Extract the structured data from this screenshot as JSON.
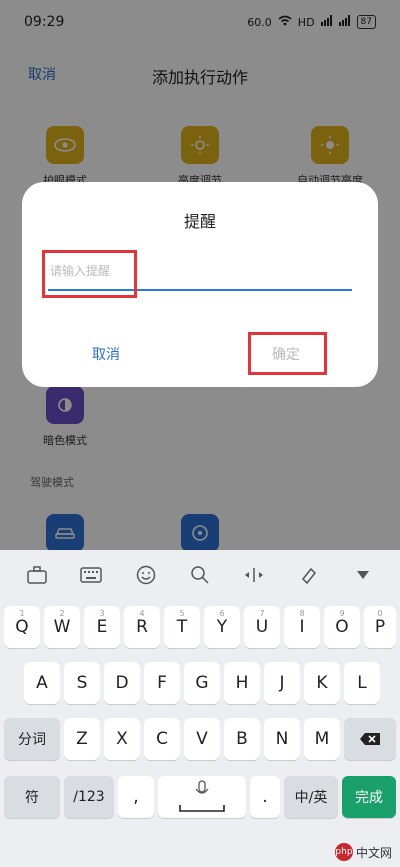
{
  "status": {
    "time": "09:29",
    "network": "60.0",
    "hd": "HD",
    "battery": "87"
  },
  "nav": {
    "cancel": "取消",
    "title": "添加执行动作"
  },
  "actions": [
    {
      "label": "护眼模式",
      "icon": "eye-icon"
    },
    {
      "label": "亮度调节",
      "icon": "sun-icon"
    },
    {
      "label": "自动调节亮度",
      "icon": "auto-brightness-icon"
    },
    {
      "label": "暗色模式",
      "icon": "dark-mode-icon"
    }
  ],
  "section": {
    "label": "驾驶模式"
  },
  "dialog": {
    "title": "提醒",
    "placeholder": "请输入提醒",
    "cancel": "取消",
    "ok": "确定"
  },
  "keyboard": {
    "row1": [
      "Q",
      "W",
      "E",
      "R",
      "T",
      "Y",
      "U",
      "I",
      "O",
      "P"
    ],
    "row1_sub": [
      "1",
      "2",
      "3",
      "4",
      "5",
      "6",
      "7",
      "8",
      "9",
      "0"
    ],
    "row2": [
      "A",
      "S",
      "D",
      "F",
      "G",
      "H",
      "J",
      "K",
      "L"
    ],
    "row3": [
      "Z",
      "X",
      "C",
      "V",
      "B",
      "N",
      "M"
    ],
    "row3_left": "分词",
    "row4": {
      "symbols": "符",
      "numbers": "/123",
      "space_sub": "",
      "comma": ",",
      "period": ".",
      "lang": "中/英",
      "done": "完成"
    }
  },
  "watermark": {
    "logo": "php",
    "text": "中文网"
  }
}
